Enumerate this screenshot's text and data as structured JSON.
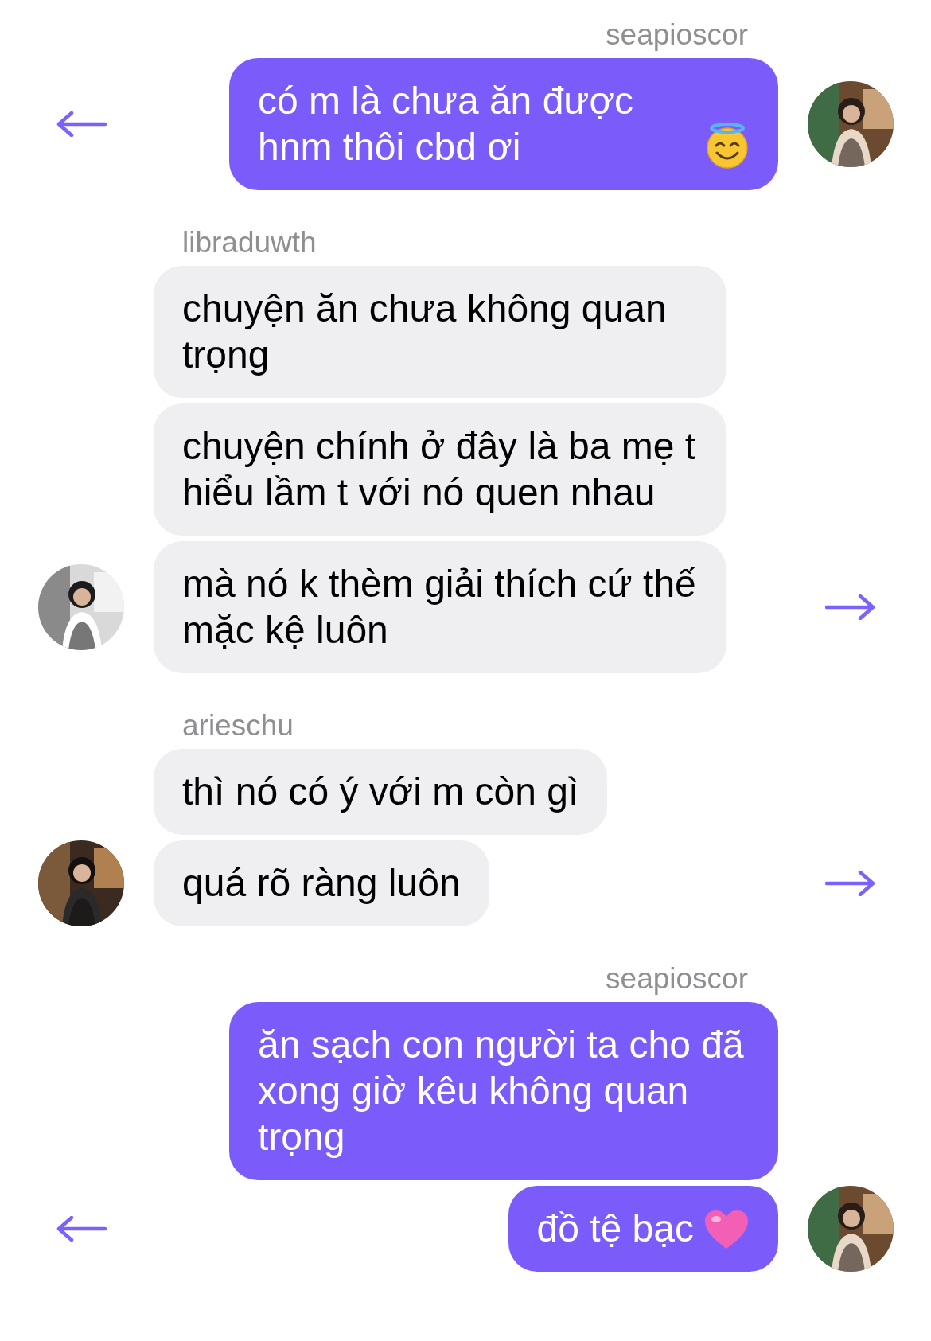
{
  "groups": [
    {
      "sender": "seapioscor",
      "sent": true,
      "messages": [
        {
          "kind": "text_halo_face",
          "text": "có m là chưa ăn được hnm thôi cbd ơi"
        }
      ]
    },
    {
      "sender": "libraduwth",
      "sent": false,
      "messages": [
        {
          "kind": "text",
          "text": "chuyện ăn chưa không quan trọng"
        },
        {
          "kind": "text",
          "text": "chuyện chính ở đây là ba mẹ t hiểu lầm t với nó quen nhau"
        },
        {
          "kind": "text",
          "text": "mà nó k thèm giải thích cứ thế mặc kệ luôn"
        }
      ]
    },
    {
      "sender": "arieschu",
      "sent": false,
      "messages": [
        {
          "kind": "text",
          "text": "thì nó có ý với m còn gì"
        },
        {
          "kind": "text",
          "text": "quá rõ ràng luôn"
        }
      ]
    },
    {
      "sender": "seapioscor",
      "sent": true,
      "messages": [
        {
          "kind": "text",
          "text": "ăn sạch con người ta cho đã xong giờ kêu không quan trọng"
        },
        {
          "kind": "text_heart",
          "text": "đồ tệ bạc"
        }
      ]
    }
  ]
}
